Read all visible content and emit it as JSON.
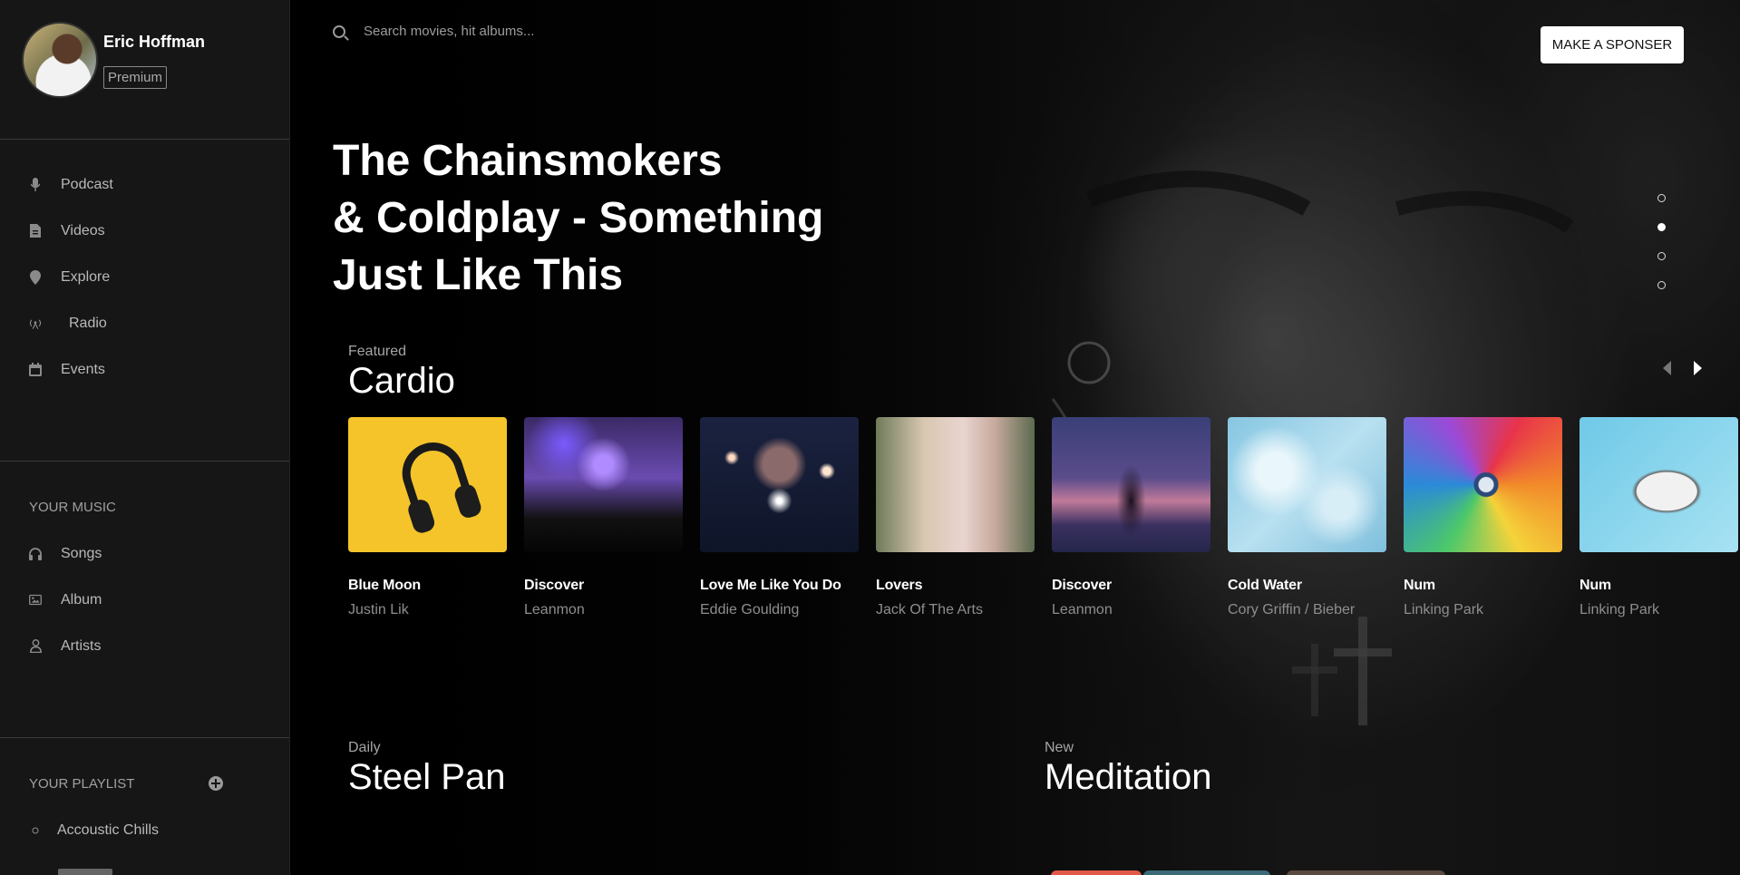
{
  "profile": {
    "name": "Eric Hoffman",
    "badge": "Premium"
  },
  "nav": [
    {
      "label": "Podcast",
      "icon": "microphone-icon"
    },
    {
      "label": "Videos",
      "icon": "file-icon"
    },
    {
      "label": "Explore",
      "icon": "map-pin-icon"
    },
    {
      "label": "Radio",
      "icon": "broadcast-icon"
    },
    {
      "label": "Events",
      "icon": "calendar-icon"
    }
  ],
  "your_music": {
    "title": "YOUR MUSIC",
    "items": [
      {
        "label": "Songs",
        "icon": "headphones-icon"
      },
      {
        "label": "Album",
        "icon": "image-icon"
      },
      {
        "label": "Artists",
        "icon": "user-icon"
      }
    ]
  },
  "your_playlist": {
    "title": "YOUR PLAYLIST",
    "items": [
      {
        "label": "Accoustic Chills",
        "icon": "circle-icon"
      }
    ]
  },
  "search": {
    "placeholder": "Search movies, hit albums..."
  },
  "sponsor_button": "MAKE A SPONSER",
  "hero": {
    "title_lines": [
      "The Chainsmokers",
      "& Coldplay - Something",
      "Just Like This"
    ],
    "slides": 4,
    "active_slide": 1
  },
  "featured": {
    "subtitle": "Featured",
    "title": "Cardio",
    "cards": [
      {
        "title": "Blue Moon",
        "artist": "Justin Lik"
      },
      {
        "title": "Discover",
        "artist": "Leanmon"
      },
      {
        "title": "Love Me Like You Do",
        "artist": "Eddie Goulding"
      },
      {
        "title": "Lovers",
        "artist": "Jack Of The Arts"
      },
      {
        "title": "Discover",
        "artist": "Leanmon"
      },
      {
        "title": "Cold Water",
        "artist": "Cory Griffin / Bieber"
      },
      {
        "title": "Num",
        "artist": "Linking Park"
      },
      {
        "title": "Num",
        "artist": "Linking Park"
      }
    ]
  },
  "daily": {
    "subtitle": "Daily",
    "title": "Steel Pan"
  },
  "new": {
    "subtitle": "New",
    "title": "Meditation"
  }
}
